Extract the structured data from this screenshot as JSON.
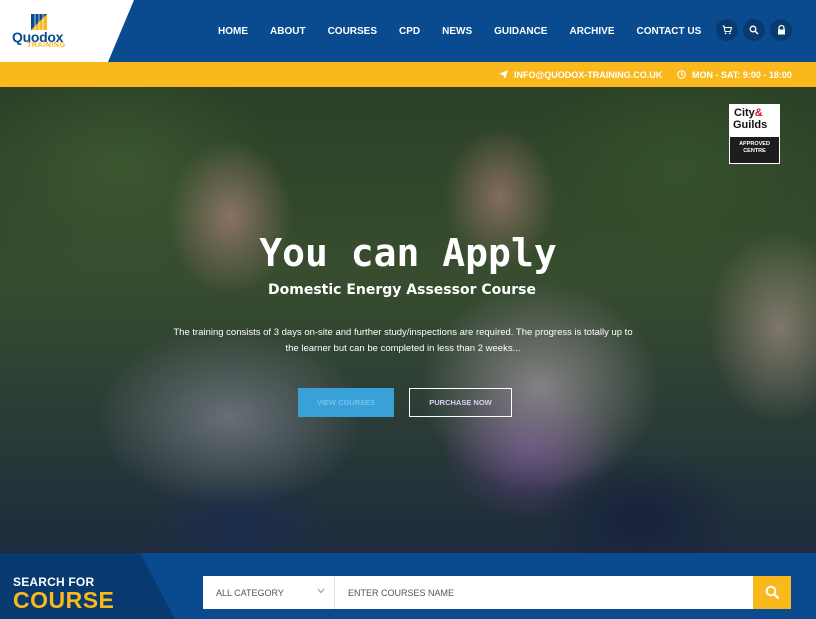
{
  "logo": {
    "name": "Quodox",
    "tagline": "TRAINING"
  },
  "nav": {
    "items": [
      {
        "label": "HOME"
      },
      {
        "label": "ABOUT"
      },
      {
        "label": "COURSES"
      },
      {
        "label": "CPD"
      },
      {
        "label": "NEWS"
      },
      {
        "label": "GUIDANCE"
      },
      {
        "label": "ARCHIVE"
      },
      {
        "label": "CONTACT US"
      }
    ],
    "icons": [
      "cart-icon",
      "search-icon",
      "lock-icon"
    ]
  },
  "infobar": {
    "email": "INFO@QUODOX-TRAINING.CO.UK",
    "hours": "MON - SAT: 9:00 - 18:00"
  },
  "hero": {
    "title": "You can Apply",
    "subtitle": "Domestic Energy Assessor Course",
    "description": "The training consists of 3 days on-site and further study/inspections are required. The progress is totally up to the learner but can be completed in less than 2 weeks...",
    "primary_button": "VIEW COURSES",
    "secondary_button": "PURCHASE NOW"
  },
  "badge": {
    "city": "City",
    "amp": "&",
    "guilds": "Guilds",
    "line1": "APPROVED",
    "line2": "CENTRE"
  },
  "search": {
    "label_top": "SEARCH FOR",
    "label_bottom": "COURSE",
    "category_value": "ALL CATEGORY",
    "input_placeholder": "ENTER COURSES NAME"
  },
  "colors": {
    "brand_blue": "#0a4a8f",
    "accent_yellow": "#f9b81b",
    "button_blue": "#3aa0d8"
  }
}
